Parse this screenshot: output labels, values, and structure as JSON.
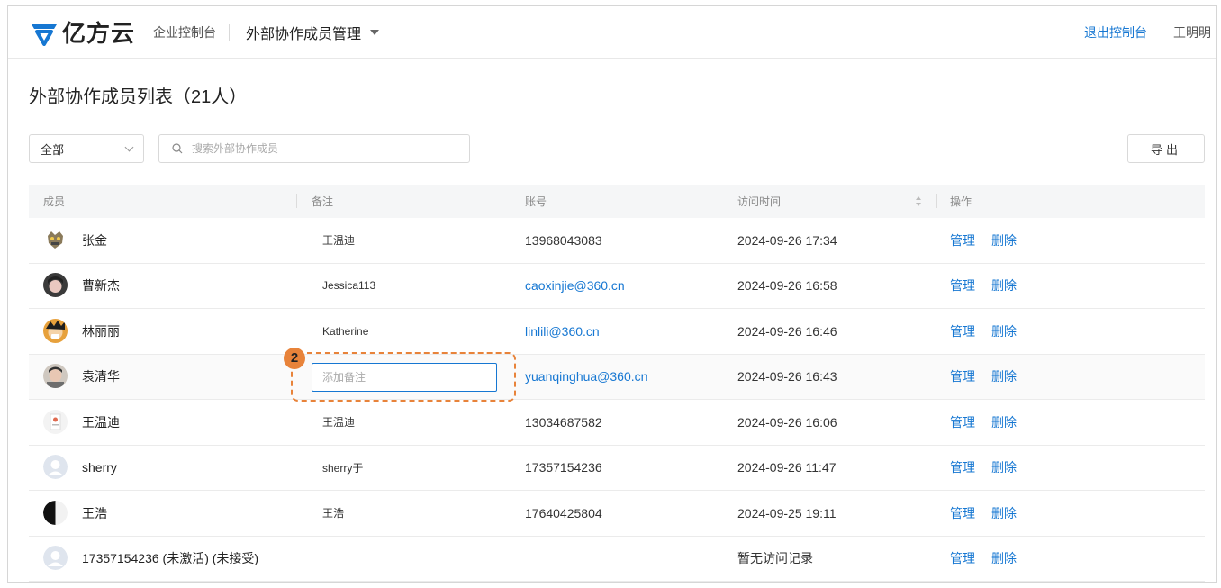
{
  "header": {
    "logo_text": "亿方云",
    "console_label": "企业控制台",
    "module_title": "外部协作成员管理",
    "exit_link": "退出控制台",
    "user_name": "王明明"
  },
  "page": {
    "title": "外部协作成员列表（21人）"
  },
  "toolbar": {
    "filter_value": "全部",
    "search_placeholder": "搜索外部协作成员",
    "export_label": "导出"
  },
  "table": {
    "columns": {
      "member": "成员",
      "remark": "备注",
      "account": "账号",
      "visit_time": "访问时间",
      "actions": "操作"
    },
    "rows": [
      {
        "name": "张金",
        "remark": "王温迪",
        "account": "13968043083",
        "time": "2024-09-26 17:34",
        "manage": "管理",
        "delete": "删除"
      },
      {
        "name": "曹新杰",
        "remark": "Jessica113",
        "account": "caoxinjie@360.cn",
        "time": "2024-09-26 16:58",
        "manage": "管理",
        "delete": "删除"
      },
      {
        "name": "林丽丽",
        "remark": "Katherine",
        "account": "linlili@360.cn",
        "time": "2024-09-26 16:46",
        "manage": "管理",
        "delete": "删除"
      },
      {
        "name": "袁清华",
        "remark_placeholder": "添加备注",
        "account": "yuanqinghua@360.cn",
        "time": "2024-09-26 16:43",
        "manage": "管理",
        "delete": "删除"
      },
      {
        "name": "王温迪",
        "remark": "王温迪",
        "account": "13034687582",
        "time": "2024-09-26 16:06",
        "manage": "管理",
        "delete": "删除"
      },
      {
        "name": "sherry",
        "remark": "sherry于",
        "account": "17357154236",
        "time": "2024-09-26 11:47",
        "manage": "管理",
        "delete": "删除"
      },
      {
        "name": "王浩",
        "remark": "王浩",
        "account": "17640425804",
        "time": "2024-09-25 19:11",
        "manage": "管理",
        "delete": "删除"
      },
      {
        "name": "17357154236 (未激活) (未接受)",
        "remark": "",
        "account": "",
        "time": "暂无访问记录",
        "manage": "管理",
        "delete": "删除"
      }
    ]
  },
  "annotation": {
    "step_number": "2"
  },
  "colors": {
    "accent": "#1677d2",
    "highlight": "#e8833a"
  }
}
